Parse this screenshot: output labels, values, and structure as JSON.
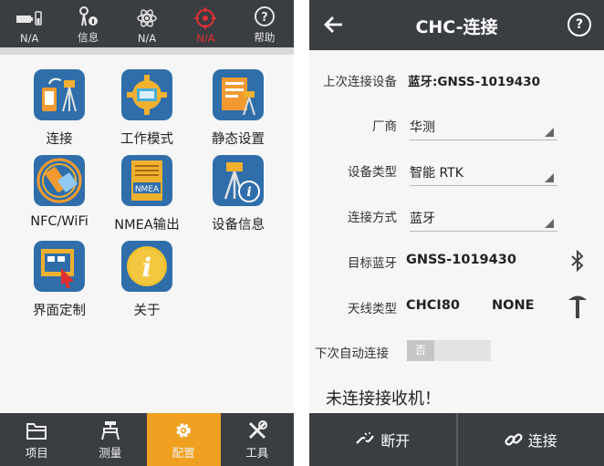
{
  "left": {
    "status": [
      {
        "label": "N/A",
        "icon": "receiver-battery-icon"
      },
      {
        "label": "信息",
        "icon": "satellite-info-icon"
      },
      {
        "label": "N/A",
        "icon": "atom-icon"
      },
      {
        "label": "N/A",
        "icon": "crosshair-icon"
      },
      {
        "label": "帮助",
        "icon": "help-icon"
      }
    ],
    "tiles": [
      {
        "label": "连接",
        "icon": "connect-icon"
      },
      {
        "label": "工作模式",
        "icon": "work-mode-icon"
      },
      {
        "label": "静态设置",
        "icon": "static-settings-icon"
      },
      {
        "label": "NFC/WiFi",
        "icon": "nfc-wifi-icon"
      },
      {
        "label": "NMEA输出",
        "icon": "nmea-output-icon"
      },
      {
        "label": "设备信息",
        "icon": "device-info-icon"
      },
      {
        "label": "界面定制",
        "icon": "ui-customize-icon"
      },
      {
        "label": "关于",
        "icon": "about-icon"
      }
    ],
    "nmea_badge": "NMEA",
    "nav": [
      {
        "label": "项目",
        "icon": "folder-icon"
      },
      {
        "label": "测量",
        "icon": "survey-icon"
      },
      {
        "label": "配置",
        "icon": "gear-icon"
      },
      {
        "label": "工具",
        "icon": "tools-icon"
      }
    ]
  },
  "right": {
    "title": "CHC-连接",
    "help": "?",
    "last_device": {
      "label": "上次连接设备",
      "value": "蓝牙:GNSS-1019430"
    },
    "vendor": {
      "label": "厂商",
      "value": "华测"
    },
    "device_type": {
      "label": "设备类型",
      "value": "智能 RTK"
    },
    "conn_method": {
      "label": "连接方式",
      "value": "蓝牙"
    },
    "target_bt": {
      "label": "目标蓝牙",
      "value": "GNSS-1019430"
    },
    "antenna": {
      "label": "天线类型",
      "value": "CHCI80",
      "value2": "NONE"
    },
    "auto_connect": {
      "label": "下次自动连接",
      "toggle": "否"
    },
    "status": "未连接接收机！",
    "buttons": {
      "disconnect": "断开",
      "connect": "连接"
    }
  },
  "colors": {
    "bar": "#3a3d42",
    "accent": "#f0a020",
    "tile_blue": "#2f6eaa",
    "alert": "#e03030"
  }
}
